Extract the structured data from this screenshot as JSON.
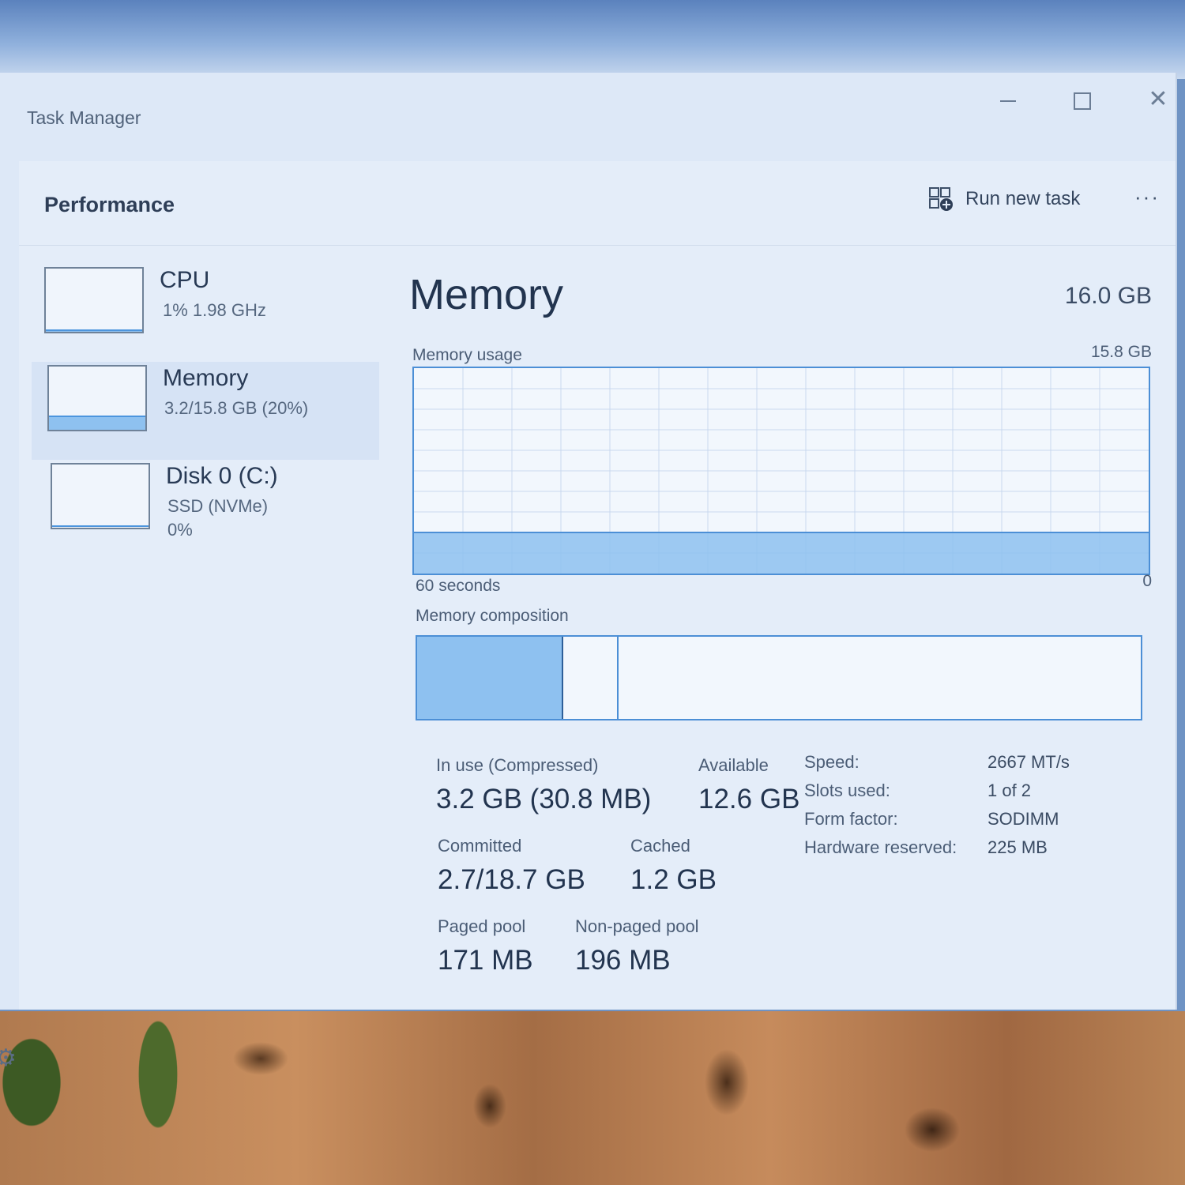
{
  "window": {
    "title": "Task Manager"
  },
  "header": {
    "title": "Performance",
    "run_new_task": "Run new task",
    "more": "···"
  },
  "sidebar": {
    "items": [
      {
        "name": "CPU",
        "line1": "1% 1.98 GHz",
        "line2": "",
        "usage": 0.01
      },
      {
        "name": "Memory",
        "line1": "3.2/15.8 GB (20%)",
        "line2": "",
        "usage": 0.2
      },
      {
        "name": "Disk 0 (C:)",
        "line1": "SSD (NVMe)",
        "line2": "0%",
        "usage": 0.0
      }
    ]
  },
  "memory": {
    "title": "Memory",
    "total": "16.0 GB",
    "usage_label": "Memory usage",
    "usage_max": "15.8 GB",
    "usage_fraction": 0.2,
    "axis_left": "60 seconds",
    "axis_right": "0",
    "composition_label": "Memory composition",
    "composition": {
      "in_use_fraction": 0.2,
      "modified_fraction": 0.076
    }
  },
  "stats": {
    "in_use": {
      "label": "In use (Compressed)",
      "value": "3.2 GB (30.8 MB)"
    },
    "available": {
      "label": "Available",
      "value": "12.6 GB"
    },
    "committed": {
      "label": "Committed",
      "value": "2.7/18.7 GB"
    },
    "cached": {
      "label": "Cached",
      "value": "1.2 GB"
    },
    "paged_pool": {
      "label": "Paged pool",
      "value": "171 MB"
    },
    "non_paged_pool": {
      "label": "Non-paged pool",
      "value": "196 MB"
    }
  },
  "specs": [
    {
      "key": "Speed:",
      "value": "2667 MT/s"
    },
    {
      "key": "Slots used:",
      "value": "1 of 2"
    },
    {
      "key": "Form factor:",
      "value": "SODIMM"
    },
    {
      "key": "Hardware reserved:",
      "value": "225 MB"
    }
  ],
  "colors": {
    "accent": "#4c8fd6",
    "fill": "#8ec1f0",
    "background": "#e4edf9"
  }
}
